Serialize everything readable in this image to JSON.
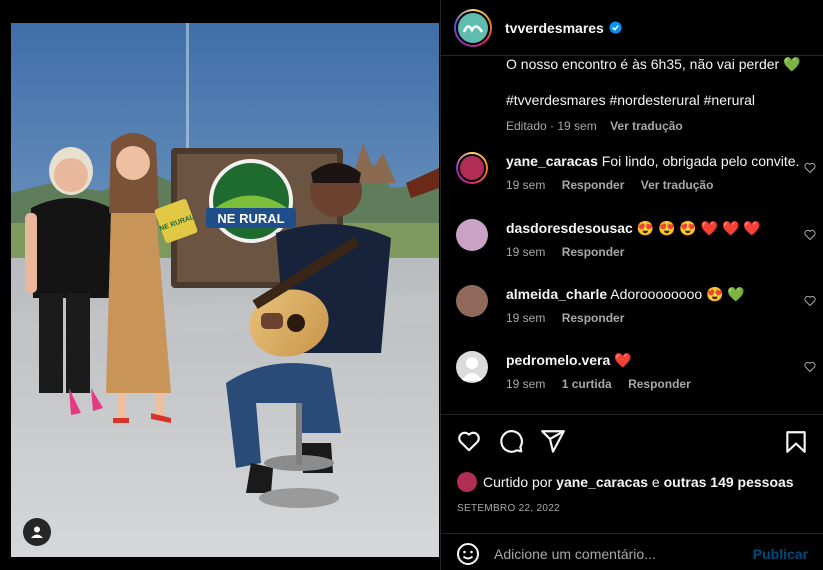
{
  "post": {
    "username": "tvverdesmares",
    "caption_line": "O nosso encontro é às 6h35, não vai perder 💚",
    "hashtags": "#tvverdesmares #nordesterural #nerural",
    "caption_edited": "Editado · 19 sem",
    "see_translation": "Ver tradução",
    "photo_sign_text": "NE RURAL",
    "photo_card_text": "NE RURAL"
  },
  "comments": [
    {
      "username": "yane_caracas",
      "text": "Foi lindo, obrigada pelo convite.",
      "time": "19 sem",
      "reply": "Responder",
      "translate": "Ver tradução"
    },
    {
      "username": "dasdoresdesousac",
      "text": "😍 😍 😍 ❤️ ❤️ ❤️",
      "time": "19 sem",
      "reply": "Responder"
    },
    {
      "username": "almeida_charle",
      "text": "Adoroooooooo 😍 💚",
      "time": "19 sem",
      "reply": "Responder"
    },
    {
      "username": "pedromelo.vera",
      "text": "❤️",
      "time": "19 sem",
      "likes": "1 curtida",
      "reply": "Responder"
    }
  ],
  "likes_line": {
    "prefix": "Curtido por",
    "user": "yane_caracas",
    "middle": "e",
    "others": "outras 149 pessoas"
  },
  "date": "SETEMBRO 22, 2022",
  "add_comment": {
    "placeholder": "Adicione um comentário...",
    "post": "Publicar"
  },
  "icons": [
    "heart-icon",
    "comment-icon",
    "share-icon",
    "bookmark-icon",
    "emoji-icon",
    "verified-icon",
    "user-tag-icon"
  ],
  "colors": {
    "background": "#000000",
    "muted": "#a8a8a8",
    "link": "#0095f6",
    "verified": "#0095f6",
    "heart_red": "#ff3040"
  }
}
